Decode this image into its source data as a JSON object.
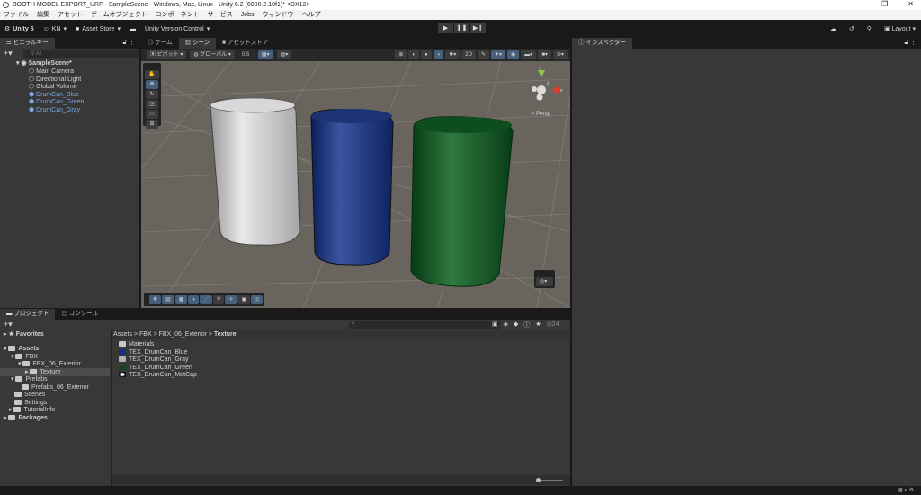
{
  "window": {
    "title": "BOOTH MODEL EXPORT_URP - SampleScene - Windows, Mac, Linux - Unity 6.2 (6000.2.10f1)* <DX12>",
    "controls": [
      "─",
      "❐",
      "✕"
    ]
  },
  "menu": [
    "ファイル",
    "編集",
    "アセット",
    "ゲームオブジェクト",
    "コンポーネント",
    "サービス",
    "Jobs",
    "ウィンドウ",
    "ヘルプ"
  ],
  "toolbar": {
    "unity": "Unity 6",
    "account": "KN",
    "asset_store": "Asset Store",
    "version_control": "Unity Version Control",
    "layout": "Layout"
  },
  "hierarchy": {
    "tab": "ヒエラルキー",
    "search_placeholder": "All",
    "scene": "SampleScene*",
    "items": [
      {
        "label": "Main Camera",
        "prefab": false
      },
      {
        "label": "Directional Light",
        "prefab": false
      },
      {
        "label": "Global Volume",
        "prefab": false
      },
      {
        "label": "DrumCan_Blue",
        "prefab": true
      },
      {
        "label": "DrumCan_Green",
        "prefab": true
      },
      {
        "label": "DrumCan_Gray",
        "prefab": true
      }
    ]
  },
  "scene_tabs": [
    "ゲーム",
    "シーン",
    "アセットストア"
  ],
  "scene_toolbar": {
    "pivot": "ピボット",
    "global": "グローバル",
    "snap": "0.5",
    "persp": "< Persp",
    "gizmo_axes": [
      "y",
      "x",
      "z"
    ]
  },
  "inspector": {
    "tab": "インスペクター"
  },
  "project": {
    "tabs": [
      "プロジェクト",
      "コンソール"
    ],
    "favorites": "Favorites",
    "tree": [
      {
        "label": "Assets",
        "depth": 0,
        "bold": true
      },
      {
        "label": "FBX",
        "depth": 1
      },
      {
        "label": "FBX_06_Exterior",
        "depth": 2
      },
      {
        "label": "Texture",
        "depth": 3,
        "selected": true
      },
      {
        "label": "Prefabs",
        "depth": 1
      },
      {
        "label": "Prefabs_06_Exterior",
        "depth": 2
      },
      {
        "label": "Scenes",
        "depth": 1
      },
      {
        "label": "Settings",
        "depth": 1
      },
      {
        "label": "TutorialInfo",
        "depth": 1
      },
      {
        "label": "Packages",
        "depth": 0,
        "bold": true
      }
    ],
    "breadcrumb": [
      "Assets",
      "FBX",
      "FBX_06_Exterior",
      "Texture"
    ],
    "files": [
      {
        "label": "Materials",
        "color": "#c8c8c8"
      },
      {
        "label": "TEX_DrumCan_Blue",
        "color": "#1a2f78"
      },
      {
        "label": "TEX_DrumCan_Gray",
        "color": "#b0b0b0"
      },
      {
        "label": "TEX_DrumCan_Green",
        "color": "#0e4a1c"
      },
      {
        "label": "TEX_DrumCan_MatCap",
        "color": "#ffffff"
      }
    ],
    "hidden_count": "24"
  }
}
